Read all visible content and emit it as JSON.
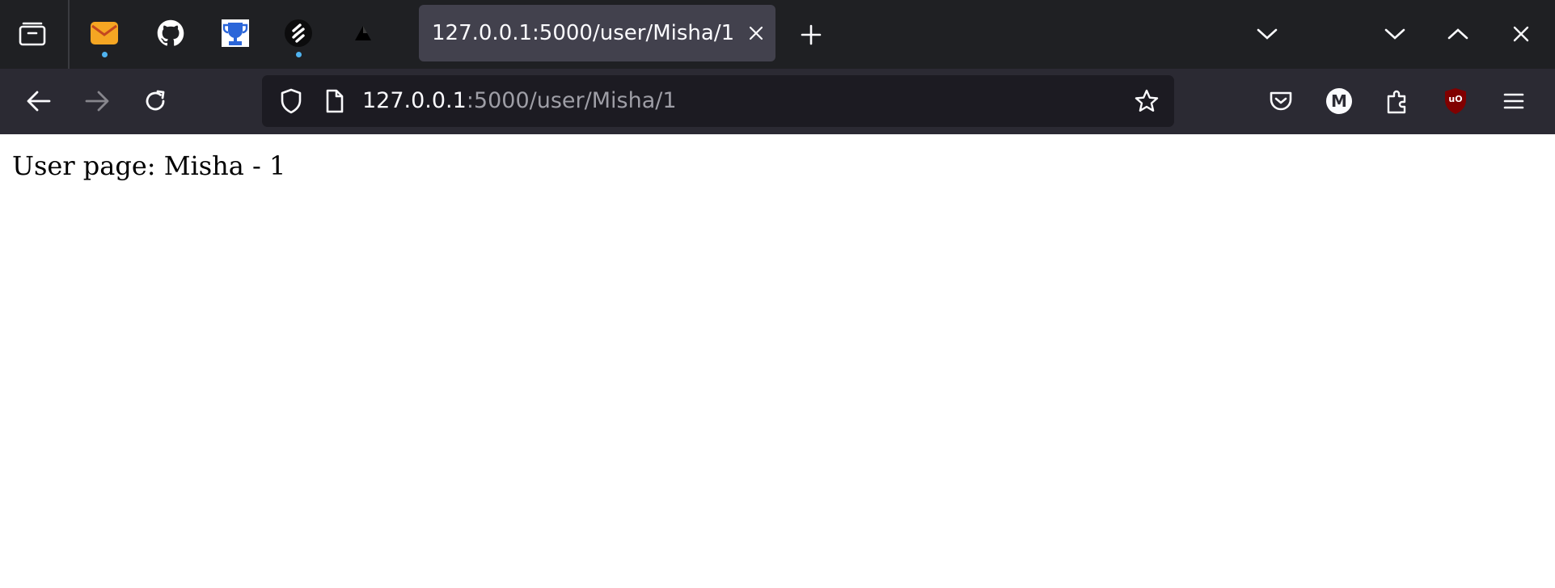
{
  "tabs": {
    "pinned": [
      {
        "name": "mail",
        "icon": "envelope-icon",
        "color": "#f5a623",
        "has_notification": true
      },
      {
        "name": "github",
        "icon": "github-icon",
        "color": "#ffffff",
        "has_notification": false
      },
      {
        "name": "trophy",
        "icon": "trophy-icon",
        "color": "#2b66d9",
        "has_notification": false
      },
      {
        "name": "swimlane",
        "icon": "s-logo-icon",
        "color": "#ffffff",
        "has_notification": true
      },
      {
        "name": "triangle",
        "icon": "triangle-icon",
        "color": "#000000",
        "has_notification": false
      }
    ],
    "active": {
      "title": "127.0.0.1:5000/user/Misha/1",
      "close_icon": "close-icon"
    }
  },
  "urlbar": {
    "host": "127.0.0.1",
    "path": ":5000/user/Misha/1"
  },
  "page": {
    "text": "User page: Misha - 1"
  },
  "theme": {
    "tabbar_bg": "#1f2023",
    "toolbar_bg": "#2b2a33",
    "urlbar_bg": "#1c1b22",
    "ublock_red": "#800000"
  },
  "toolbar": {
    "account_initial": "M",
    "ublock_label": "uO"
  }
}
